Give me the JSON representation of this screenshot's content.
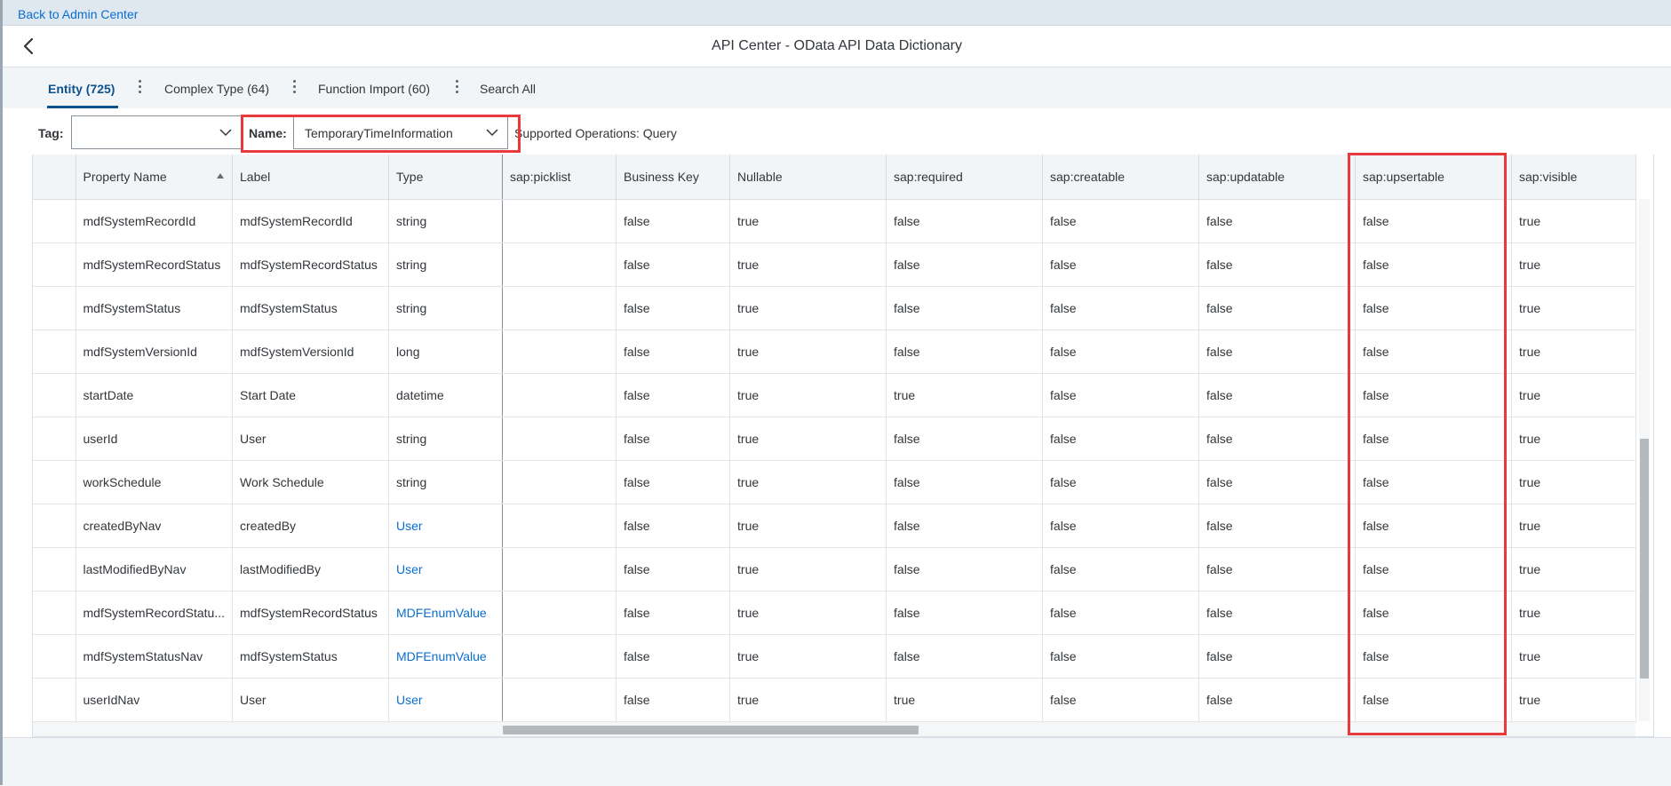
{
  "topbar": {
    "back_link": "Back to Admin Center"
  },
  "header": {
    "title": "API Center - OData API Data Dictionary"
  },
  "tabs": [
    {
      "label": "Entity (725)",
      "active": true
    },
    {
      "label": "Complex Type (64)",
      "active": false
    },
    {
      "label": "Function Import (60)",
      "active": false
    },
    {
      "label": "Search All",
      "active": false
    }
  ],
  "filters": {
    "tag_label": "Tag:",
    "tag_value": "",
    "name_label": "Name:",
    "name_value": "TemporaryTimeInformation",
    "supported_operations": "Supported Operations: Query"
  },
  "table": {
    "sorted_column": "Property Name",
    "sort_direction": "ascending",
    "highlighted_column": "sap:upsertable",
    "columns": [
      "",
      "Property Name",
      "Label",
      "Type",
      "sap:picklist",
      "Business Key",
      "Nullable",
      "sap:required",
      "sap:creatable",
      "sap:updatable",
      "sap:upsertable",
      "sap:visible"
    ],
    "rows": [
      {
        "name": "mdfSystemRecordId",
        "label": "mdfSystemRecordId",
        "type": "string",
        "type_link": false,
        "picklist": "",
        "business_key": "false",
        "nullable": "true",
        "required": "false",
        "creatable": "false",
        "updatable": "false",
        "upsertable": "false",
        "visible": "true"
      },
      {
        "name": "mdfSystemRecordStatus",
        "label": "mdfSystemRecordStatus",
        "type": "string",
        "type_link": false,
        "picklist": "",
        "business_key": "false",
        "nullable": "true",
        "required": "false",
        "creatable": "false",
        "updatable": "false",
        "upsertable": "false",
        "visible": "true"
      },
      {
        "name": "mdfSystemStatus",
        "label": "mdfSystemStatus",
        "type": "string",
        "type_link": false,
        "picklist": "",
        "business_key": "false",
        "nullable": "true",
        "required": "false",
        "creatable": "false",
        "updatable": "false",
        "upsertable": "false",
        "visible": "true"
      },
      {
        "name": "mdfSystemVersionId",
        "label": "mdfSystemVersionId",
        "type": "long",
        "type_link": false,
        "picklist": "",
        "business_key": "false",
        "nullable": "true",
        "required": "false",
        "creatable": "false",
        "updatable": "false",
        "upsertable": "false",
        "visible": "true"
      },
      {
        "name": "startDate",
        "label": "Start Date",
        "type": "datetime",
        "type_link": false,
        "picklist": "",
        "business_key": "false",
        "nullable": "true",
        "required": "true",
        "creatable": "false",
        "updatable": "false",
        "upsertable": "false",
        "visible": "true"
      },
      {
        "name": "userId",
        "label": "User",
        "type": "string",
        "type_link": false,
        "picklist": "",
        "business_key": "false",
        "nullable": "true",
        "required": "false",
        "creatable": "false",
        "updatable": "false",
        "upsertable": "false",
        "visible": "true"
      },
      {
        "name": "workSchedule",
        "label": "Work Schedule",
        "type": "string",
        "type_link": false,
        "picklist": "",
        "business_key": "false",
        "nullable": "true",
        "required": "false",
        "creatable": "false",
        "updatable": "false",
        "upsertable": "false",
        "visible": "true"
      },
      {
        "name": "createdByNav",
        "label": "createdBy",
        "type": "User",
        "type_link": true,
        "picklist": "",
        "business_key": "false",
        "nullable": "true",
        "required": "false",
        "creatable": "false",
        "updatable": "false",
        "upsertable": "false",
        "visible": "true"
      },
      {
        "name": "lastModifiedByNav",
        "label": "lastModifiedBy",
        "type": "User",
        "type_link": true,
        "picklist": "",
        "business_key": "false",
        "nullable": "true",
        "required": "false",
        "creatable": "false",
        "updatable": "false",
        "upsertable": "false",
        "visible": "true"
      },
      {
        "name": "mdfSystemRecordStatu...",
        "label": "mdfSystemRecordStatus",
        "type": "MDFEnumValue",
        "type_link": true,
        "picklist": "",
        "business_key": "false",
        "nullable": "true",
        "required": "false",
        "creatable": "false",
        "updatable": "false",
        "upsertable": "false",
        "visible": "true"
      },
      {
        "name": "mdfSystemStatusNav",
        "label": "mdfSystemStatus",
        "type": "MDFEnumValue",
        "type_link": true,
        "picklist": "",
        "business_key": "false",
        "nullable": "true",
        "required": "false",
        "creatable": "false",
        "updatable": "false",
        "upsertable": "false",
        "visible": "true"
      },
      {
        "name": "userIdNav",
        "label": "User",
        "type": "User",
        "type_link": true,
        "picklist": "",
        "business_key": "false",
        "nullable": "true",
        "required": "true",
        "creatable": "false",
        "updatable": "false",
        "upsertable": "false",
        "visible": "true"
      }
    ]
  },
  "colors": {
    "accent": "#0a6ed1",
    "highlight": "#e8393d",
    "header_bg": "#f2f5f8"
  }
}
